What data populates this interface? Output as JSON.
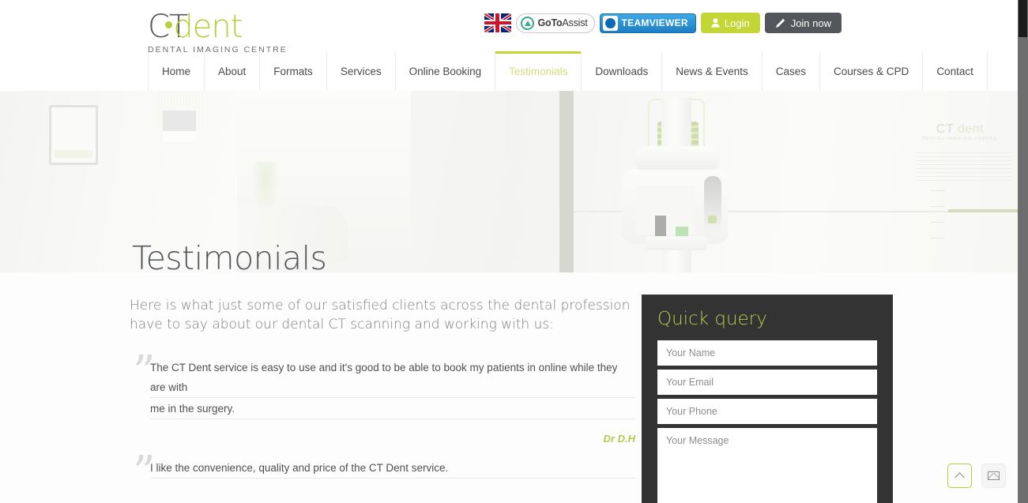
{
  "header": {
    "logo": {
      "ct": "CT",
      "dent": "dent",
      "tagline": "DENTAL IMAGING CENTRE"
    },
    "tools": {
      "flag_name": "uk-flag",
      "gotoassist_bold": "GoTo",
      "gotoassist_rest": "Assist",
      "teamviewer": "TEAMVIEWER",
      "login": "Login",
      "join": "Join now"
    }
  },
  "nav": {
    "items": [
      {
        "label": "Home",
        "active": false
      },
      {
        "label": "About",
        "active": false
      },
      {
        "label": "Formats",
        "active": false
      },
      {
        "label": "Services",
        "active": false
      },
      {
        "label": "Online Booking",
        "active": false
      },
      {
        "label": "Testimonials",
        "active": true
      },
      {
        "label": "Downloads",
        "active": false
      },
      {
        "label": "News & Events",
        "active": false
      },
      {
        "label": "Cases",
        "active": false
      },
      {
        "label": "Courses & CPD",
        "active": false
      },
      {
        "label": "Contact",
        "active": false
      }
    ]
  },
  "hero": {
    "title": "Testimonials",
    "wall_sign_main_ct": "CT",
    "wall_sign_main_dent": "dent",
    "wall_sign_sub": "DENTAL IMAGING CENTRE"
  },
  "main": {
    "intro": "Here is what just some of our satisfied clients across the dental profession have to say about our dental CT scanning and working with us:",
    "quotes": [
      {
        "line1": "The CT Dent service is easy to use and it's good to be able to book my patients in online while they are with",
        "line2": "me in the surgery.",
        "author": "Dr D.H"
      },
      {
        "line1": "I like the convenience, quality and price of the CT Dent service.",
        "line2": "",
        "author": ""
      }
    ]
  },
  "quick_query": {
    "title": "Quick query",
    "name_placeholder": "Your Name",
    "email_placeholder": "Your Email",
    "phone_placeholder": "Your Phone",
    "message_placeholder": "Your Message",
    "name_value": "",
    "email_value": "",
    "phone_value": "",
    "message_value": ""
  },
  "floating": {
    "scroll_top": "scroll-to-top",
    "contact": "contact-mail"
  },
  "colors": {
    "accent_green": "#c3d635",
    "logo_green": "#b6cf3a",
    "dark_panel": "#333333",
    "nav_text": "#4a4a4a",
    "author_green": "#b6c84e"
  }
}
